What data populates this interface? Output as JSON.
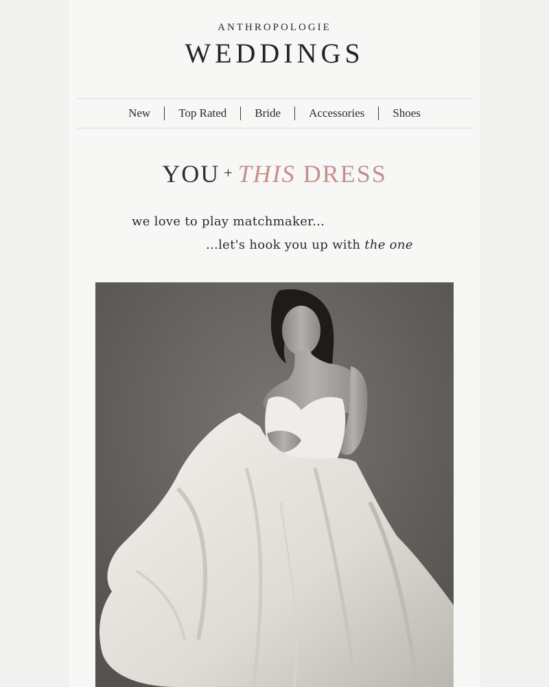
{
  "brand": {
    "name": "ANTHROPOLOGIE",
    "line": "WEDDINGS"
  },
  "nav": {
    "items": [
      {
        "label": "New"
      },
      {
        "label": "Top Rated"
      },
      {
        "label": "Bride"
      },
      {
        "label": "Accessories"
      },
      {
        "label": "Shoes"
      }
    ]
  },
  "headline": {
    "part1": "YOU",
    "plus": "+",
    "part2": "THIS",
    "part3": "DRESS"
  },
  "tagline": {
    "line1": "we love to play matchmaker...",
    "line2_prefix": "...let's hook you up with ",
    "line2_italic": "the one"
  },
  "hero": {
    "image_icon": "bride-photo-icon"
  },
  "colors": {
    "accent": "#c58e8c",
    "background": "#f7f7f6",
    "text": "#2b2b2b"
  }
}
